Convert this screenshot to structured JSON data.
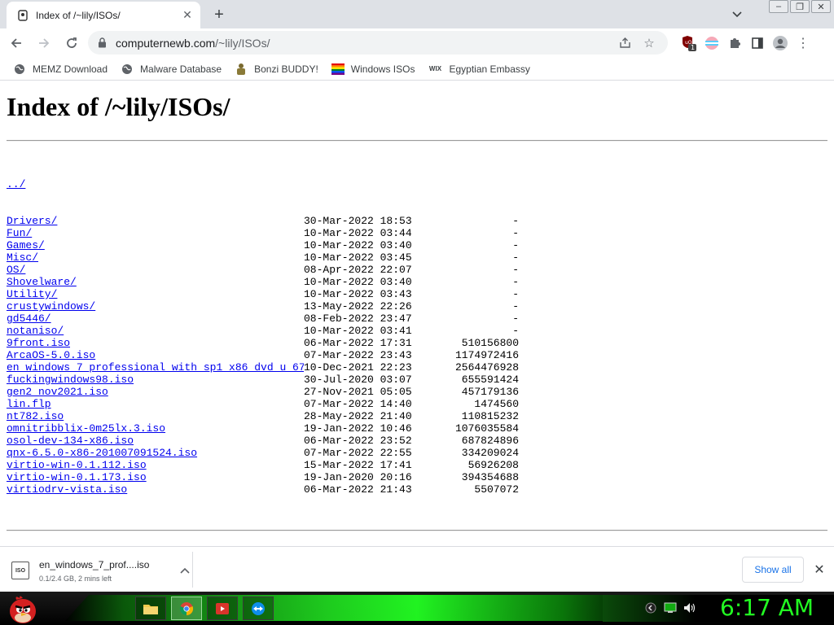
{
  "browser": {
    "tab_title": "Index of /~lily/ISOs/",
    "url_host": "computernewb.com",
    "url_path": "/~lily/ISOs/",
    "extension_badge": "1"
  },
  "bookmarks": [
    {
      "label": "MEMZ Download",
      "icon": "globe-icon"
    },
    {
      "label": "Malware Database",
      "icon": "globe-icon"
    },
    {
      "label": "Bonzi BUDDY!",
      "icon": "bonzi-icon"
    },
    {
      "label": "Windows ISOs",
      "icon": "windows-flag-icon"
    },
    {
      "label": "Egyptian Embassy",
      "icon": "wix-icon"
    }
  ],
  "page": {
    "heading": "Index of /~lily/ISOs/",
    "parent_link": "../",
    "entries": [
      {
        "name": "Drivers/",
        "date": "30-Mar-2022 18:53",
        "size": "-"
      },
      {
        "name": "Fun/",
        "date": "10-Mar-2022 03:44",
        "size": "-"
      },
      {
        "name": "Games/",
        "date": "10-Mar-2022 03:40",
        "size": "-"
      },
      {
        "name": "Misc/",
        "date": "10-Mar-2022 03:45",
        "size": "-"
      },
      {
        "name": "OS/",
        "date": "08-Apr-2022 22:07",
        "size": "-"
      },
      {
        "name": "Shovelware/",
        "date": "10-Mar-2022 03:40",
        "size": "-"
      },
      {
        "name": "Utility/",
        "date": "10-Mar-2022 03:43",
        "size": "-"
      },
      {
        "name": "crustywindows/",
        "date": "13-May-2022 22:26",
        "size": "-"
      },
      {
        "name": "gd5446/",
        "date": "08-Feb-2022 23:47",
        "size": "-"
      },
      {
        "name": "notaniso/",
        "date": "10-Mar-2022 03:41",
        "size": "-"
      },
      {
        "name": "9front.iso",
        "date": "06-Mar-2022 17:31",
        "size": "510156800"
      },
      {
        "name": "ArcaOS-5.0.iso",
        "date": "07-Mar-2022 23:43",
        "size": "1174972416"
      },
      {
        "name": "en_windows_7_professional_with_sp1_x86_dvd_u_67..>",
        "date": "10-Dec-2021 22:23",
        "size": "2564476928"
      },
      {
        "name": "fuckingwindows98.iso",
        "date": "30-Jul-2020 03:07",
        "size": "655591424"
      },
      {
        "name": "gen2_nov2021.iso",
        "date": "27-Nov-2021 05:05",
        "size": "457179136"
      },
      {
        "name": "lin.flp",
        "date": "07-Mar-2022 14:40",
        "size": "1474560"
      },
      {
        "name": "nt782.iso",
        "date": "28-May-2022 21:40",
        "size": "110815232"
      },
      {
        "name": "omnitribblix-0m25lx.3.iso",
        "date": "19-Jan-2022 10:46",
        "size": "1076035584"
      },
      {
        "name": "osol-dev-134-x86.iso",
        "date": "06-Mar-2022 23:52",
        "size": "687824896"
      },
      {
        "name": "qnx-6.5.0-x86-201007091524.iso",
        "date": "07-Mar-2022 22:55",
        "size": "334209024"
      },
      {
        "name": "virtio-win-0.1.112.iso",
        "date": "15-Mar-2022 17:41",
        "size": "56926208"
      },
      {
        "name": "virtio-win-0.1.173.iso",
        "date": "19-Jan-2020 20:16",
        "size": "394354688"
      },
      {
        "name": "virtiodrv-vista.iso",
        "date": "06-Mar-2022 21:43",
        "size": "5507072"
      }
    ]
  },
  "download": {
    "file_icon_text": "ISO",
    "filename": "en_windows_7_prof....iso",
    "status": "0.1/2.4 GB, 2 mins left",
    "show_all": "Show all"
  },
  "taskbar": {
    "clock": "6:17 AM",
    "accent": "#22ff22"
  }
}
